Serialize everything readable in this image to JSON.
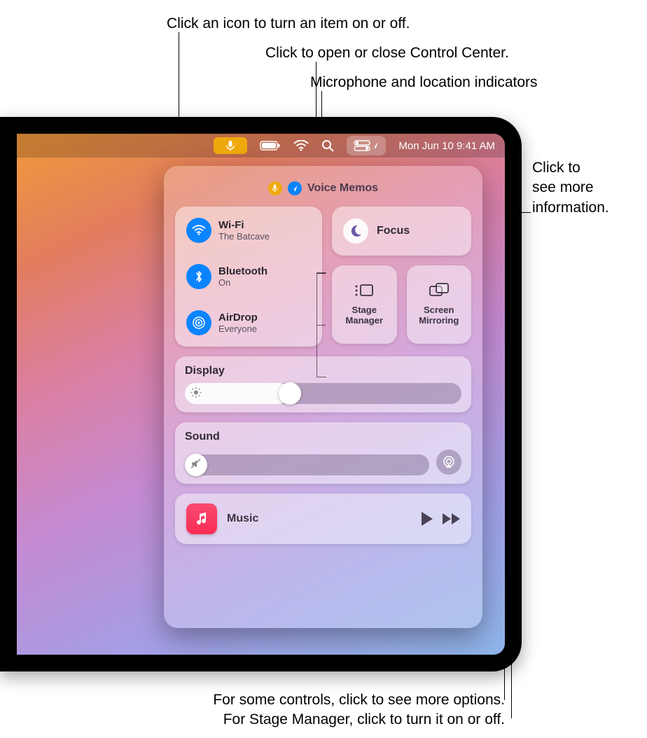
{
  "callouts": {
    "toggle": "Click an icon to turn an item on or off.",
    "open_cc": "Click to open or close Control Center.",
    "indicators": "Microphone and location indicators",
    "more_info": "Click to\nsee more\ninformation.",
    "more_options_1": "For some controls, click to see more options.",
    "more_options_2": "For Stage Manager, click to turn it on or off."
  },
  "menubar": {
    "datetime": "Mon Jun 10  9:41 AM"
  },
  "cc": {
    "app_using": "Voice Memos",
    "wifi": {
      "label": "Wi-Fi",
      "status": "The Batcave"
    },
    "bluetooth": {
      "label": "Bluetooth",
      "status": "On"
    },
    "airdrop": {
      "label": "AirDrop",
      "status": "Everyone"
    },
    "focus": {
      "label": "Focus"
    },
    "stage": {
      "label_1": "Stage",
      "label_2": "Manager"
    },
    "mirror": {
      "label_1": "Screen",
      "label_2": "Mirroring"
    },
    "display": {
      "label": "Display",
      "value_pct": 38
    },
    "sound": {
      "label": "Sound",
      "value_pct": 0
    },
    "music": {
      "label": "Music"
    }
  }
}
